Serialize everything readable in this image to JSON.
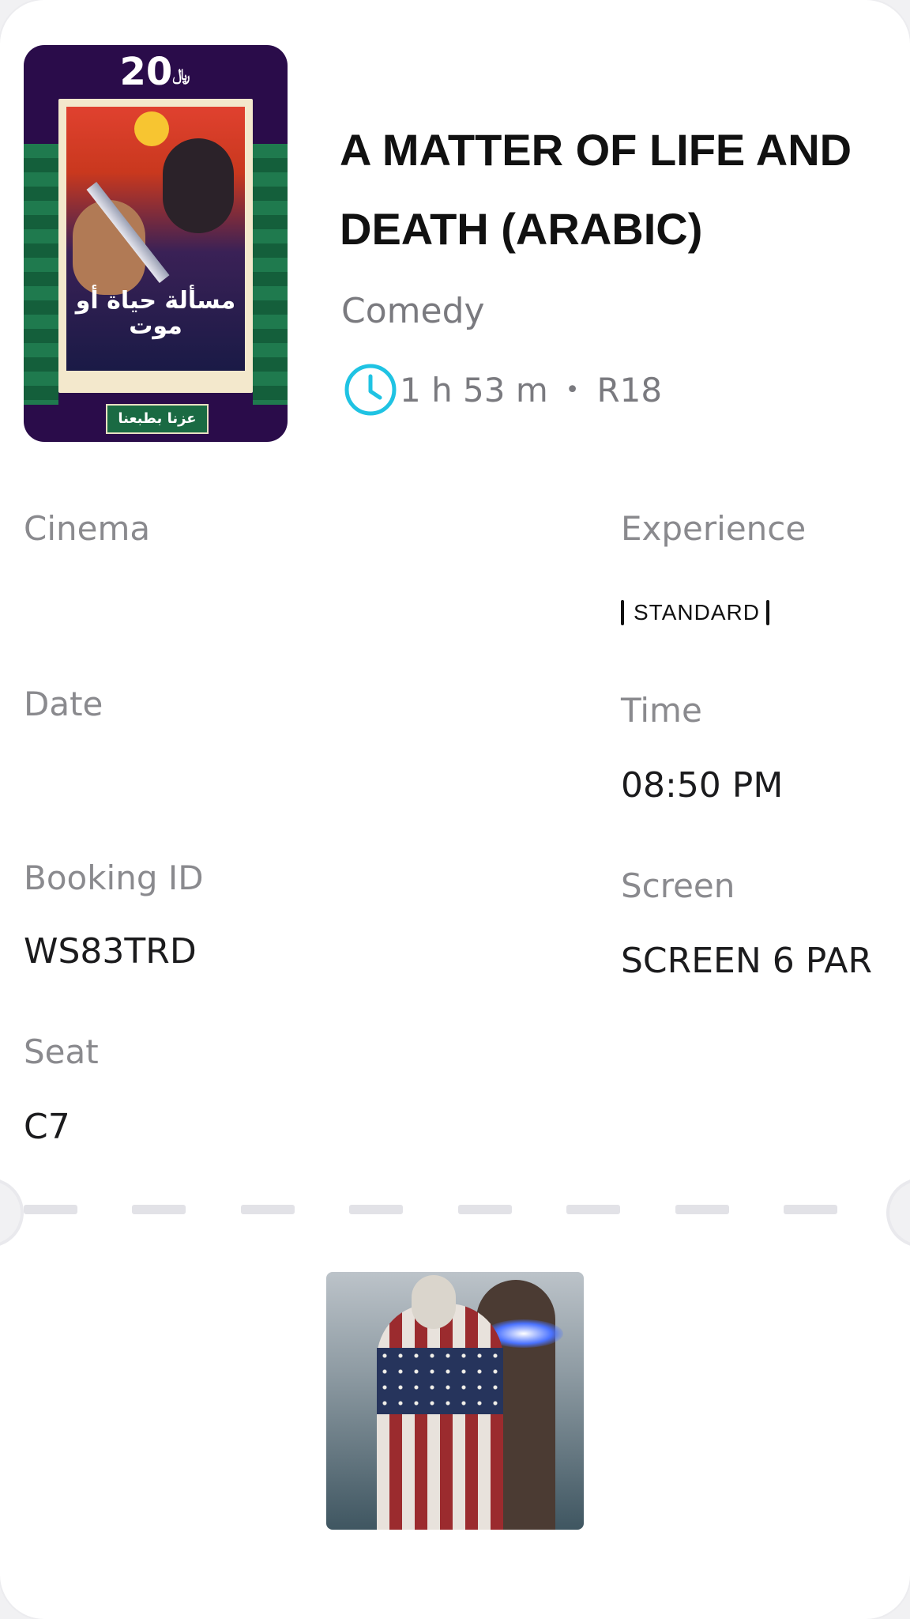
{
  "poster": {
    "price": "20",
    "currency_symbol": "﷼",
    "arabic_title": "مسألة حياة أو موت",
    "badge_text": "عزنا بطبعنا"
  },
  "movie": {
    "title": "A MATTER OF LIFE AND DEATH (ARABIC)",
    "genre": "Comedy",
    "duration": "1 h 53 m",
    "separator": "•",
    "rating": "R18",
    "duration_icon": "clock-icon"
  },
  "labels": {
    "cinema": "Cinema",
    "experience": "Experience",
    "date": "Date",
    "time": "Time",
    "booking_id": "Booking ID",
    "screen": "Screen",
    "seat": "Seat"
  },
  "values": {
    "cinema": "",
    "experience": "STANDARD",
    "date": "",
    "time": "08:50 PM",
    "booking_id": "WS83TRD",
    "screen": "SCREEN 6 PAR",
    "seat": "C7"
  },
  "colors": {
    "accent": "#1fc3e3",
    "label": "#8a8a8e",
    "value": "#1b1b1d"
  }
}
